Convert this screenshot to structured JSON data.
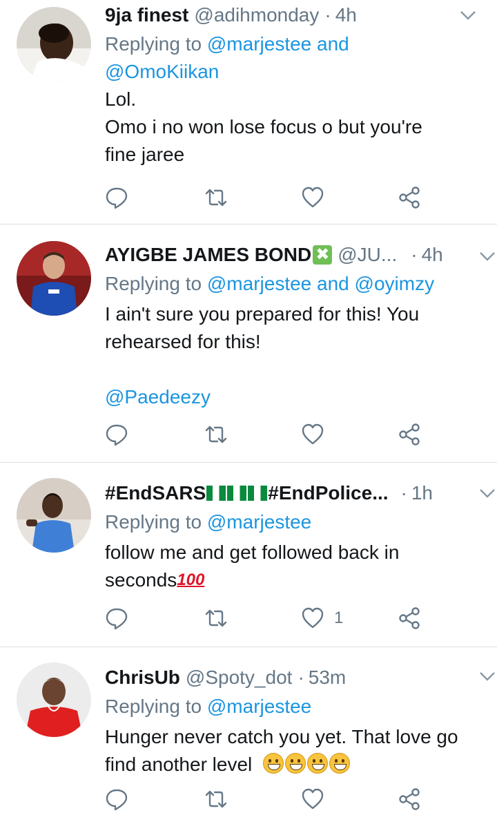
{
  "colors": {
    "link": "#1b95e0",
    "muted": "#657786",
    "text": "#14171a",
    "divider": "#dcdfe2"
  },
  "tweets": [
    {
      "name": "9ja finest",
      "handle": "@adihmonday",
      "dot": "·",
      "time": "4h",
      "reply_prefix": "Replying to",
      "reply_mentions": [
        "@marjestee",
        "@OmoKiikan"
      ],
      "reply_and": "and",
      "text_lines": [
        "Lol.",
        "Omo i no won lose focus o but you're",
        "fine jaree"
      ],
      "icons": [
        "reply-icon",
        "retweet-icon",
        "like-icon",
        "share-icon"
      ],
      "like_count": ""
    },
    {
      "name": "AYIGBE JAMES BOND",
      "name_emoji": "✖",
      "handle": "@JU...",
      "dot": "·",
      "time": "4h",
      "reply_prefix": "Replying to",
      "reply_mentions": [
        "@marjestee",
        "@oyimzy"
      ],
      "reply_and": "and",
      "text_lines": [
        "I ain't sure you prepared for this! You",
        "rehearsed for this!"
      ],
      "mention_line": "@Paedeezy",
      "icons": [
        "reply-icon",
        "retweet-icon",
        "like-icon",
        "share-icon"
      ],
      "like_count": ""
    },
    {
      "name_prefix": "#EndSARS",
      "name_suffix": "#EndPolice...",
      "dot": "·",
      "time": "1h",
      "reply_prefix": "Replying to",
      "reply_mentions": [
        "@marjestee"
      ],
      "text_lines": [
        "follow me and get followed back in",
        "seconds"
      ],
      "hundred": "100",
      "icons": [
        "reply-icon",
        "retweet-icon",
        "like-icon",
        "share-icon"
      ],
      "like_count": "1"
    },
    {
      "name": "ChrisUb",
      "handle": "@Spoty_dot",
      "dot": "·",
      "time": "53m",
      "reply_prefix": "Replying to",
      "reply_mentions": [
        "@marjestee"
      ],
      "text_lines": [
        "Hunger never catch you yet. That love go",
        "find another level"
      ],
      "icons": [
        "reply-icon",
        "retweet-icon",
        "like-icon",
        "share-icon"
      ],
      "like_count": ""
    }
  ]
}
